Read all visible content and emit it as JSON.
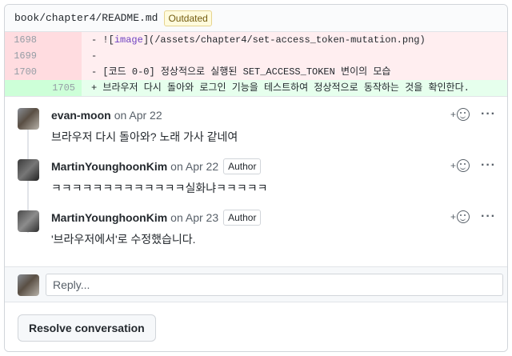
{
  "file": {
    "path": "book/chapter4/README.md",
    "badge": "Outdated"
  },
  "diff": {
    "rows": [
      {
        "old": "1698",
        "new": "",
        "type": "del",
        "text": "- ![image](/assets/chapter4/set-access_token-mutation.png)"
      },
      {
        "old": "1699",
        "new": "",
        "type": "del",
        "text": "-"
      },
      {
        "old": "1700",
        "new": "",
        "type": "del",
        "text": "- [코드 0-0] 정상적으로 실행된 SET_ACCESS_TOKEN 변이의 모습"
      },
      {
        "old": "",
        "new": "1705",
        "type": "add",
        "text": "+ 브라우저 다시 돌아와 로그인 기능을 테스트하여 정상적으로 동작하는 것을 확인한다."
      }
    ]
  },
  "comments": [
    {
      "author": "evan-moon",
      "date": "on Apr 22",
      "badge": "",
      "body": "브라우저 다시 돌아와? 노래 가사 같네여"
    },
    {
      "author": "MartinYounghoonKim",
      "date": "on Apr 22",
      "badge": "Author",
      "body": "ㅋㅋㅋㅋㅋㅋㅋㅋㅋㅋㅋㅋㅋ실화냐ㅋㅋㅋㅋㅋ"
    },
    {
      "author": "MartinYounghoonKim",
      "date": "on Apr 23",
      "badge": "Author",
      "body": "'브라우저에서'로 수정했습니다."
    }
  ],
  "reply": {
    "placeholder": "Reply..."
  },
  "footer": {
    "resolve_label": "Resolve conversation"
  },
  "icons": {
    "reaction": "smiley-icon",
    "more": "kebab-icon"
  },
  "colors": {
    "del_bg": "#ffeef0",
    "add_bg": "#e6ffed",
    "badge_bg": "#fffbdd"
  }
}
